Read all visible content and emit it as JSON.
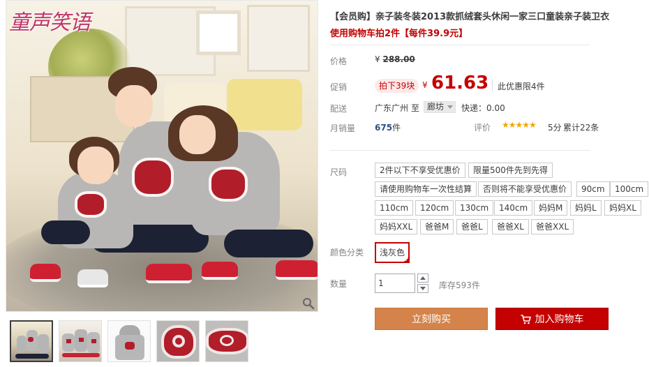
{
  "gallery": {
    "logo_text": "童声笑语",
    "thumbnails": [
      {
        "name": "family-photo",
        "active": true
      },
      {
        "name": "family-sofa-photo",
        "active": false
      },
      {
        "name": "hoodie-photo",
        "active": false
      },
      {
        "name": "heart-print-closeup",
        "active": false
      },
      {
        "name": "heart-print-detail",
        "active": false
      }
    ],
    "zoom_icon": "magnifier-icon"
  },
  "product": {
    "title": "【会员购】亲子装冬装2013款抓绒套头休闲一家三口童装亲子装卫衣",
    "subtitle": "使用购物车拍2件【每件39.9元】"
  },
  "price": {
    "label": "价格",
    "currency": "¥",
    "original": "288.00"
  },
  "promo": {
    "label": "促销",
    "tag": "拍下39块",
    "currency": "¥",
    "price": "61.63",
    "limit": "此优惠限4件"
  },
  "shipping": {
    "label": "配送",
    "from": "广东广州",
    "to_label": "至",
    "to_value": "廊坊",
    "fee": "快递：0.00"
  },
  "sales": {
    "label": "月销量",
    "count": "675",
    "unit": "件",
    "rating_label": "评价",
    "stars": "★★★★★",
    "score": "5分",
    "reviews": "累计22条"
  },
  "size": {
    "label": "尺码",
    "options": [
      "2件以下不享受优惠价",
      "限量500件先到先得",
      "请使用购物车一次性结算",
      "否则将不能享受优惠价",
      "90cm",
      "100cm",
      "110cm",
      "120cm",
      "130cm",
      "140cm",
      "妈妈M",
      "妈妈L",
      "妈妈XL",
      "妈妈XXL",
      "爸爸M",
      "爸爸L",
      "爸爸XL",
      "爸爸XXL"
    ]
  },
  "color": {
    "label": "颜色分类",
    "selected": "浅灰色"
  },
  "quantity": {
    "label": "数量",
    "value": "1",
    "stock": "库存593件"
  },
  "actions": {
    "buy_now": "立刻购买",
    "add_to_cart": "加入购物车"
  },
  "colors": {
    "accent_red": "#c40000",
    "buy_orange": "#d4844b",
    "star_gold": "#f2a400"
  }
}
